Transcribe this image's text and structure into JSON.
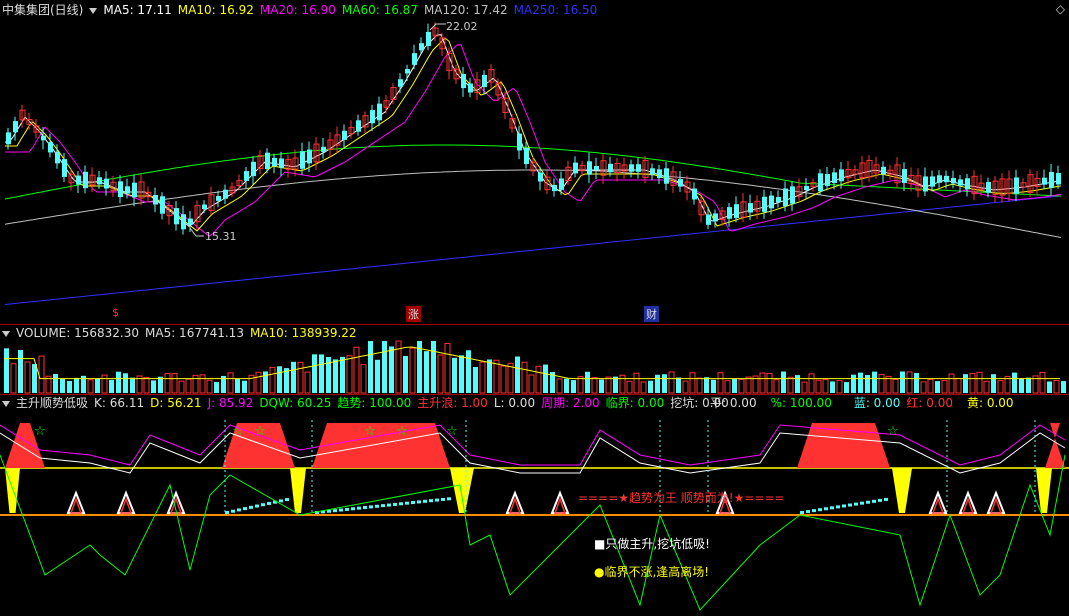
{
  "colors": {
    "up": "#ff3232",
    "down": "#54fcfc",
    "ma5": "#ffffff",
    "ma10": "#ffff00",
    "ma20": "#ff00ff",
    "ma60": "#00ff00",
    "ma120": "#c0c0c0",
    "ma250": "#3030ff",
    "separator": "#a00000"
  },
  "main": {
    "title": "中集集团(日线)",
    "ma5": "MA5: 17.11",
    "ma10": "MA10: 16.92",
    "ma20": "MA20: 16.90",
    "ma60": "MA60: 16.87",
    "ma120": "MA120: 17.42",
    "ma250": "MA250: 16.50",
    "high_label": "22.02",
    "low_label": "15.31",
    "markers": [
      "$",
      "涨",
      "财"
    ]
  },
  "volume": {
    "label": "VOLUME: 156832.30",
    "ma5": "MA5: 167741.13",
    "ma10": "MA10: 138939.22"
  },
  "indicator": {
    "name": "主升顺势低吸",
    "k": "K: 66.11",
    "d": "D: 56.21",
    "j": "J: 85.92",
    "dqw": "DQW: 60.25",
    "trend": "趋势: 100.00",
    "main_rise": "主升浪: 1.00",
    "l": "L: 0.00",
    "cycle": "周期: 2.00",
    "critical": "临界: 0.00",
    "dig": "挖坑: 0.00",
    "flat": "平: 0.00",
    "pct": "%: 100.00",
    "blue": "蓝: 0.00",
    "red": "红: 0.00",
    "yellow": "黄: 0.00",
    "banner": "====★趋势为王 顺势而为!★====",
    "note1": "■只做主升,挖坑低吸!",
    "note2": "●临界不涨,逢高离场!"
  }
}
